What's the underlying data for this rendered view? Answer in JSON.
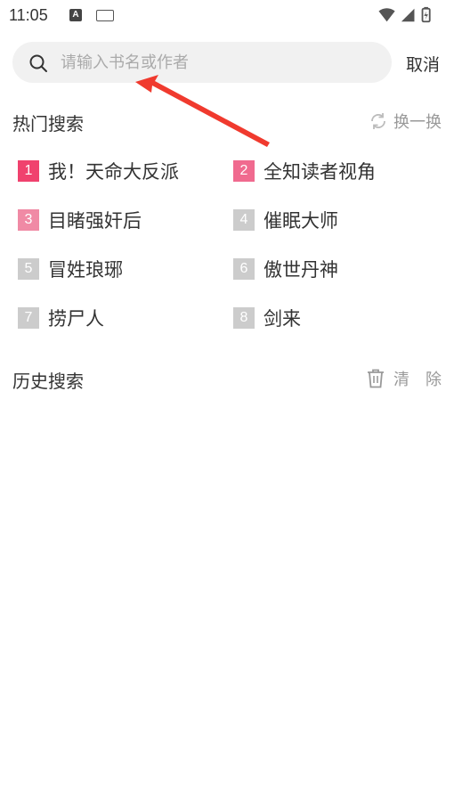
{
  "status_bar": {
    "time": "11:05",
    "icons": [
      "a-icon",
      "keyboard-icon",
      "wifi-icon",
      "signal-icon",
      "battery-icon"
    ]
  },
  "search": {
    "placeholder": "请输入书名或作者",
    "cancel_label": "取消"
  },
  "hot": {
    "title": "热门搜索",
    "refresh_label": "换一换",
    "items": [
      {
        "rank": "1",
        "title": "我！天命大反派",
        "color": "#f0426e"
      },
      {
        "rank": "2",
        "title": "全知读者视角",
        "color": "#f06a8f"
      },
      {
        "rank": "3",
        "title": "目睹强奸后",
        "color": "#f08aa5"
      },
      {
        "rank": "4",
        "title": "催眠大师",
        "color": "#cccccc"
      },
      {
        "rank": "5",
        "title": "冒姓琅琊",
        "color": "#cccccc"
      },
      {
        "rank": "6",
        "title": "傲世丹神",
        "color": "#cccccc"
      },
      {
        "rank": "7",
        "title": "捞尸人",
        "color": "#cccccc"
      },
      {
        "rank": "8",
        "title": "剑来",
        "color": "#cccccc"
      }
    ]
  },
  "history": {
    "title": "历史搜索",
    "clear_label": "清　除"
  },
  "annotation": {
    "arrow_color": "#f03a2e"
  }
}
